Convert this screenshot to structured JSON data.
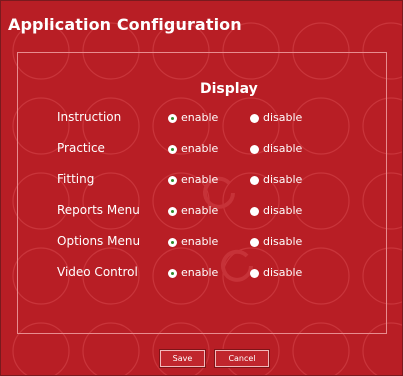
{
  "window": {
    "title": "Application Configuration"
  },
  "section": {
    "heading": "Display"
  },
  "options": {
    "enable_label": "enable",
    "disable_label": "disable"
  },
  "settings": [
    {
      "label": "Instruction",
      "selected": "enable"
    },
    {
      "label": "Practice",
      "selected": "enable"
    },
    {
      "label": "Fitting",
      "selected": "enable"
    },
    {
      "label": "Reports Menu",
      "selected": "enable"
    },
    {
      "label": "Options Menu",
      "selected": "enable"
    },
    {
      "label": "Video Control",
      "selected": "enable"
    }
  ],
  "buttons": {
    "save_label": "Save",
    "cancel_label": "Cancel"
  },
  "colors": {
    "background": "#b81e25",
    "selected_dot": "#2f8a2a",
    "panel_border": "#e88c8f"
  }
}
